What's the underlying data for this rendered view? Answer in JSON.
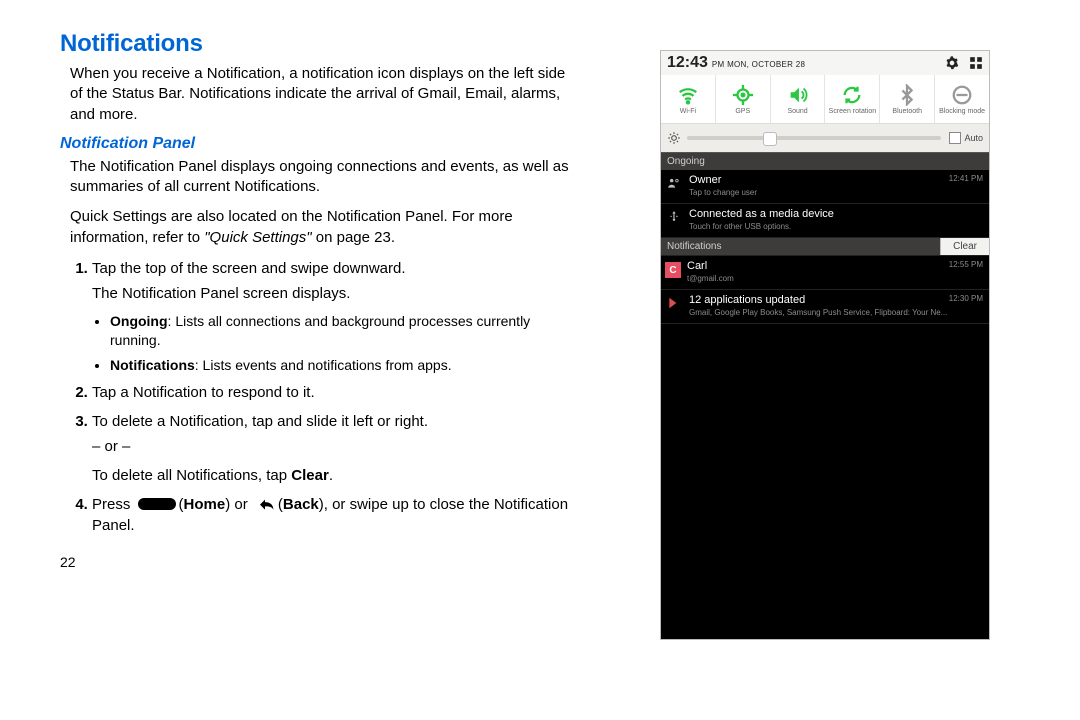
{
  "heading": "Notifications",
  "intro": "When you receive a Notification, a notification icon displays on the left side of the Status Bar. Notifications indicate the arrival of Gmail, Email, alarms, and more.",
  "subheading": "Notification Panel",
  "panel_p1": "The Notification Panel displays ongoing connections and events, as well as summaries of all current Notifications.",
  "panel_p2a": "Quick Settings are also located on the Notification Panel. For more information, refer to ",
  "panel_p2_ref": "\"Quick Settings\"",
  "panel_p2b": " on page 23.",
  "step1_a": "Tap the top of the screen and swipe downward.",
  "step1_b": "The Notification Panel screen displays.",
  "step1_bullet1_b": "Ongoing",
  "step1_bullet1_t": ": Lists all connections and background processes currently running.",
  "step1_bullet2_b": "Notifications",
  "step1_bullet2_t": ": Lists events and notifications from apps.",
  "step2": "Tap a Notification to respond to it.",
  "step3_a": "To delete a Notification, tap and slide it left or right.",
  "step3_or": "– or –",
  "step3_b_pre": "To delete all Notifications, tap ",
  "step3_b_bold": "Clear",
  "step3_b_post": ".",
  "step4_pre": "Press ",
  "step4_home": "Home",
  "step4_mid": " or ",
  "step4_back": "Back",
  "step4_post": ", or swipe up to close the Notification Panel.",
  "page_num": "22",
  "phone": {
    "clock": "12:43",
    "ampm": "PM",
    "date": "MON, OCTOBER 28",
    "quick": {
      "wifi": "Wi-Fi",
      "gps": "GPS",
      "sound": "Sound",
      "rotation": "Screen rotation",
      "bt": "Bluetooth",
      "block": "Blocking mode"
    },
    "brightness_auto": "Auto",
    "section_ongoing": "Ongoing",
    "owner_title": "Owner",
    "owner_sub": "Tap to change user",
    "owner_time": "12:41 PM",
    "media_title": "Connected as a media device",
    "media_sub": "Touch for other USB options.",
    "notif_label": "Notifications",
    "clear_label": "Clear",
    "carl_title": "Carl",
    "carl_sub": "t@gmail.com",
    "carl_time": "12:55 PM",
    "apps_title": "12 applications updated",
    "apps_sub": "Gmail, Google Play Books, Samsung Push Service, Flipboard: Your Ne...",
    "apps_time": "12:30 PM"
  }
}
